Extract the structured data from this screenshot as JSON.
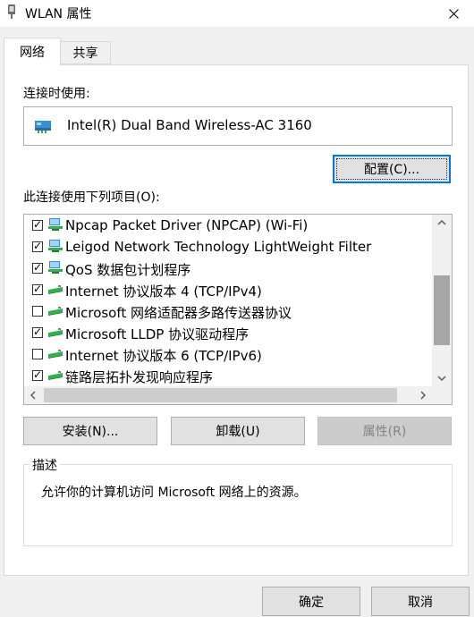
{
  "window": {
    "title": "WLAN 属性",
    "close_icon": "close-icon",
    "title_icon": "network-adapter-icon"
  },
  "tabs": [
    {
      "label": "网络",
      "selected": true
    },
    {
      "label": "共享",
      "selected": false
    }
  ],
  "connect_using": {
    "label": "连接时使用:",
    "adapter_name": "Intel(R) Dual Band Wireless-AC 3160",
    "configure_button": "配置(C)..."
  },
  "items_section": {
    "label": "此连接使用下列项目(O):",
    "items": [
      {
        "label": "Npcap Packet Driver (NPCAP) (Wi-Fi)",
        "checked": true,
        "icon": "network-client-icon"
      },
      {
        "label": "Leigod Network Technology LightWeight Filter",
        "checked": true,
        "icon": "network-client-icon"
      },
      {
        "label": "QoS 数据包计划程序",
        "checked": true,
        "icon": "network-client-icon"
      },
      {
        "label": "Internet 协议版本 4 (TCP/IPv4)",
        "checked": true,
        "icon": "protocol-icon"
      },
      {
        "label": "Microsoft 网络适配器多路传送器协议",
        "checked": false,
        "icon": "protocol-icon"
      },
      {
        "label": "Microsoft LLDP 协议驱动程序",
        "checked": true,
        "icon": "protocol-icon"
      },
      {
        "label": "Internet 协议版本 6 (TCP/IPv6)",
        "checked": false,
        "icon": "protocol-icon"
      },
      {
        "label": "链路层拓扑发现响应程序",
        "checked": true,
        "icon": "protocol-icon"
      }
    ],
    "vertical_scroll_fraction": 0.4
  },
  "actions": {
    "install": "安装(N)...",
    "uninstall": "卸载(U)",
    "properties": "属性(R)",
    "properties_enabled": false
  },
  "description": {
    "legend": "描述",
    "text": "允许你的计算机访问 Microsoft 网络上的资源。"
  },
  "footer": {
    "ok": "确定",
    "cancel": "取消"
  },
  "colors": {
    "focus_border": "#0078d7",
    "window_bg": "#f0f0f0",
    "panel_bg": "#ffffff"
  }
}
